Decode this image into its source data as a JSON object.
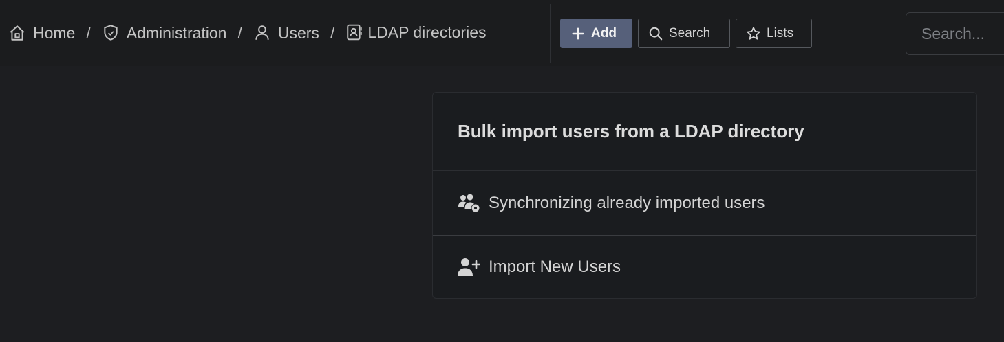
{
  "breadcrumb": {
    "items": [
      {
        "label": "Home",
        "icon": "home-icon"
      },
      {
        "label": "Administration",
        "icon": "shield-icon"
      },
      {
        "label": "Users",
        "icon": "user-icon"
      },
      {
        "label": "LDAP directories",
        "icon": "address-book-icon"
      }
    ],
    "separator": "/"
  },
  "toolbar": {
    "add_label": "Add",
    "search_label": "Search",
    "lists_label": "Lists"
  },
  "global_search": {
    "placeholder": "Search..."
  },
  "card": {
    "title": "Bulk import users from a LDAP directory",
    "items": [
      {
        "label": "Synchronizing already imported users",
        "icon": "users-gear-icon"
      },
      {
        "label": "Import New Users",
        "icon": "user-plus-icon"
      }
    ]
  },
  "colors": {
    "background": "#1d1e21",
    "topbar": "#1b1c1e",
    "primary_button": "#56607a",
    "text": "#c9c9c9"
  }
}
